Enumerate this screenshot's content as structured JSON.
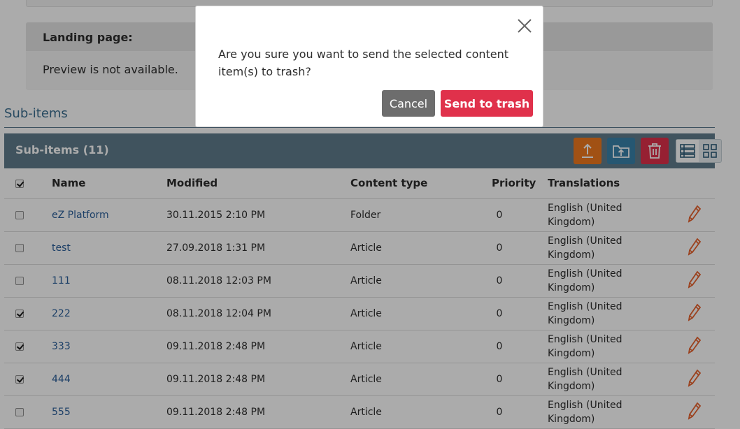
{
  "landing": {
    "title": "Landing page:",
    "preview_text": "Preview is not available."
  },
  "subitems_link": "Sub-items",
  "panel": {
    "title": "Sub-items (11)",
    "toolbar": {
      "upload_icon": "upload-icon",
      "move_icon": "folder-move-icon",
      "trash_icon": "trash-icon",
      "view_list_icon": "list-view-icon",
      "view_grid_icon": "grid-view-icon",
      "upload_color": "#f07a1f",
      "move_color": "#3a82aa",
      "trash_color": "#e0314b"
    }
  },
  "table": {
    "columns": [
      "Name",
      "Modified",
      "Content type",
      "Priority",
      "Translations"
    ],
    "header_checkbox_checked": true,
    "rows": [
      {
        "name": "eZ Platform",
        "modified": "30.11.2015 2:10 PM",
        "type": "Folder",
        "priority": "0",
        "translation_line1": "English (United",
        "translation_line2": "Kingdom)",
        "checked": false
      },
      {
        "name": "test",
        "modified": "27.09.2018 1:31 PM",
        "type": "Article",
        "priority": "0",
        "translation_line1": "English (United",
        "translation_line2": "Kingdom)",
        "checked": false
      },
      {
        "name": "111",
        "modified": "08.11.2018 12:03 PM",
        "type": "Article",
        "priority": "0",
        "translation_line1": "English (United",
        "translation_line2": "Kingdom)",
        "checked": false
      },
      {
        "name": "222",
        "modified": "08.11.2018 12:04 PM",
        "type": "Article",
        "priority": "0",
        "translation_line1": "English (United",
        "translation_line2": "Kingdom)",
        "checked": true
      },
      {
        "name": "333",
        "modified": "09.11.2018 2:48 PM",
        "type": "Article",
        "priority": "0",
        "translation_line1": "English (United",
        "translation_line2": "Kingdom)",
        "checked": true
      },
      {
        "name": "444",
        "modified": "09.11.2018 2:48 PM",
        "type": "Article",
        "priority": "0",
        "translation_line1": "English (United",
        "translation_line2": "Kingdom)",
        "checked": true
      },
      {
        "name": "555",
        "modified": "09.11.2018 2:48 PM",
        "type": "Article",
        "priority": "0",
        "translation_line1": "English (United",
        "translation_line2": "Kingdom)",
        "checked": false
      }
    ],
    "edit_icon": "pencil-icon",
    "edit_color": "#e8612c"
  },
  "modal": {
    "message": "Are you sure you want to send the selected content item(s) to trash?",
    "cancel_label": "Cancel",
    "confirm_label": "Send to trash",
    "close_icon": "close-icon"
  }
}
